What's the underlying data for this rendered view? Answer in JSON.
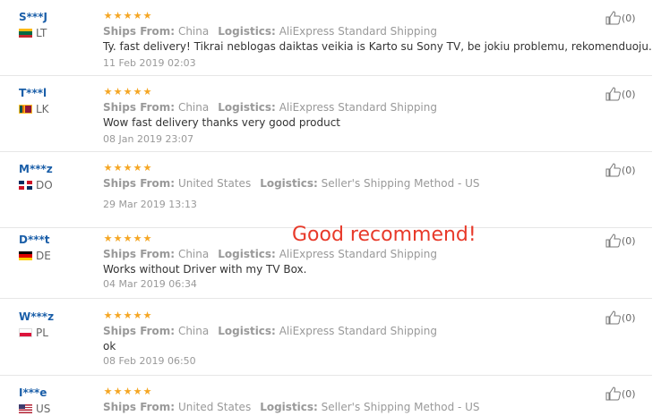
{
  "reviews": [
    {
      "user": "S***J",
      "country": "LT",
      "ships_label": "Ships From:",
      "ships": "China",
      "logistics_label": "Logistics:",
      "logistics": "AliExpress Standard Shipping",
      "text": "Ty. fast delivery! Tikrai neblogas daiktas veikia is Karto su Sony TV, be jokiu problemu, rekomenduoju.",
      "date": "11 Feb 2019 02:03",
      "helpful": "(0)",
      "stars": 5
    },
    {
      "user": "T***l",
      "country": "LK",
      "ships_label": "Ships From:",
      "ships": "China",
      "logistics_label": "Logistics:",
      "logistics": "AliExpress Standard Shipping",
      "text": "Wow fast delivery thanks very good product",
      "date": "08 Jan 2019 23:07",
      "helpful": "(0)",
      "stars": 5
    },
    {
      "user": "M***z",
      "country": "DO",
      "ships_label": "Ships From:",
      "ships": "United States",
      "logistics_label": "Logistics:",
      "logistics": "Seller's Shipping Method - US",
      "text": "",
      "date": "29 Mar 2019 13:13",
      "helpful": "(0)",
      "stars": 5
    },
    {
      "user": "D***t",
      "country": "DE",
      "ships_label": "Ships From:",
      "ships": "China",
      "logistics_label": "Logistics:",
      "logistics": "AliExpress Standard Shipping",
      "text": "Works without Driver with my TV Box.",
      "date": "04 Mar 2019 06:34",
      "helpful": "(0)",
      "stars": 5
    },
    {
      "user": "W***z",
      "country": "PL",
      "ships_label": "Ships From:",
      "ships": "China",
      "logistics_label": "Logistics:",
      "logistics": "AliExpress Standard Shipping",
      "text": "ok",
      "date": "08 Feb 2019 06:50",
      "helpful": "(0)",
      "stars": 5
    },
    {
      "user": "I***e",
      "country": "US",
      "ships_label": "Ships From:",
      "ships": "United States",
      "logistics_label": "Logistics:",
      "logistics": "Seller's Shipping Method - US",
      "text": "",
      "date": "",
      "helpful": "(0)",
      "stars": 5
    }
  ],
  "overlay_text": "Good recommend!",
  "colors": {
    "star": "#f5a623",
    "username": "#1a5ea8",
    "overlay": "#e83a2a"
  },
  "icons": {
    "star": "star-icon",
    "helpful": "thumbs-up-icon"
  }
}
